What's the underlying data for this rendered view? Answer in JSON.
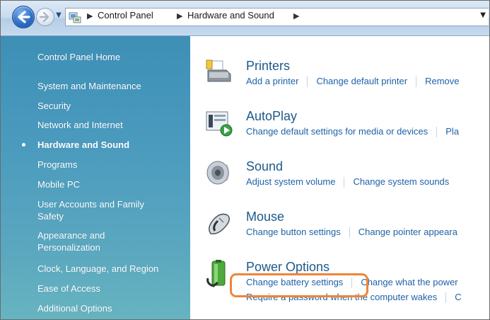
{
  "address_bar": {
    "breadcrumbs": [
      "Control Panel",
      "Hardware and Sound"
    ]
  },
  "sidebar": {
    "items": [
      {
        "label": "Control Panel Home"
      },
      {
        "label": "System and Maintenance"
      },
      {
        "label": "Security"
      },
      {
        "label": "Network and Internet"
      },
      {
        "label": "Hardware and Sound",
        "active": true
      },
      {
        "label": "Programs"
      },
      {
        "label": "Mobile PC"
      },
      {
        "label": "User Accounts and Family Safety"
      },
      {
        "label": "Appearance and Personalization"
      },
      {
        "label": "Clock, Language, and Region"
      },
      {
        "label": "Ease of Access"
      },
      {
        "label": "Additional Options"
      }
    ]
  },
  "categories": [
    {
      "title": "Printers",
      "icon": "printer-icon",
      "links": [
        "Add a printer",
        "Change default printer",
        "Remove"
      ]
    },
    {
      "title": "AutoPlay",
      "icon": "autoplay-icon",
      "links": [
        "Change default settings for media or devices",
        "Pla"
      ]
    },
    {
      "title": "Sound",
      "icon": "speaker-icon",
      "links": [
        "Adjust system volume",
        "Change system sounds"
      ]
    },
    {
      "title": "Mouse",
      "icon": "mouse-icon",
      "links": [
        "Change button settings",
        "Change pointer appeara"
      ]
    },
    {
      "title": "Power Options",
      "icon": "battery-icon",
      "links": [
        "Change battery settings",
        "Change what the power"
      ],
      "links2": [
        "Require a password when the computer wakes",
        "C"
      ]
    }
  ],
  "highlight": {
    "target": "Change battery settings",
    "color": "#ee8537"
  },
  "colors": {
    "sidebar_top": "#3d8fb6",
    "sidebar_bottom": "#67b4c0",
    "title": "#1c5a8a",
    "link": "#1e62a8"
  }
}
